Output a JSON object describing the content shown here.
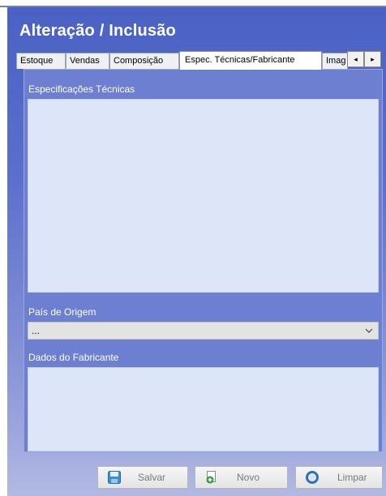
{
  "window": {
    "title": "Alteração / Inclusão"
  },
  "tabs": [
    {
      "label": "Estoque",
      "active": false
    },
    {
      "label": "Vendas",
      "active": false
    },
    {
      "label": "Composição",
      "active": false
    },
    {
      "label": "Espec. Técnicas/Fabricante",
      "active": true
    },
    {
      "label": "Imag",
      "active": false
    }
  ],
  "tab_scroll": {
    "left_icon": "arrow-left-icon",
    "right_icon": "arrow-right-icon"
  },
  "form": {
    "especificacoes_label": "Especificações Técnicas",
    "especificacoes_value": "",
    "pais_label": "País de Origem",
    "pais_value": "...",
    "fabricante_label": "Dados do Fabricante",
    "fabricante_value": ""
  },
  "buttons": {
    "salvar": {
      "label": "Salvar",
      "icon": "floppy-disk-icon"
    },
    "novo": {
      "label": "Novo",
      "icon": "new-document-icon"
    },
    "limpar": {
      "label": "Limpar",
      "icon": "clear-ring-icon"
    }
  },
  "colors": {
    "window_top": "#4a62c4",
    "panel": "#6d7fd0",
    "field": "#dde6f8"
  }
}
